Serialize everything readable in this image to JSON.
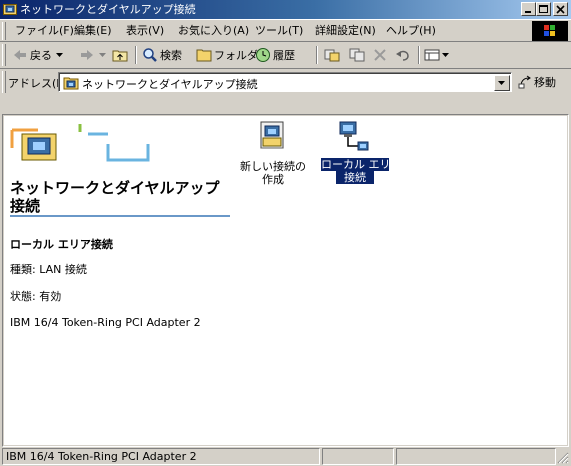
{
  "window": {
    "title": "ネットワークとダイヤルアップ接続",
    "accent": "#0a246a",
    "controls": [
      "minimize-icon",
      "maximize-icon",
      "close-icon"
    ]
  },
  "menu": {
    "items": [
      "ファイル(F)",
      "編集(E)",
      "表示(V)",
      "お気に入り(A)",
      "ツール(T)",
      "詳細設定(N)",
      "ヘルプ(H)"
    ]
  },
  "toolbar": {
    "back_label": "戻る",
    "search_label": "検索",
    "folders_label": "フォルダ",
    "history_label": "履歴"
  },
  "address": {
    "label": "アドレス(D)",
    "value": "ネットワークとダイヤルアップ接続",
    "go_label": "移動"
  },
  "sidebar": {
    "heading_line1": "ネットワークとダイヤルアップ",
    "heading_line2": "接続",
    "selected_name": "ローカル エリア接続",
    "type_text": "種類: LAN 接続",
    "status_text": "状態: 有効",
    "adapter_text": "IBM 16/4 Token-Ring PCI Adapter 2"
  },
  "files": [
    {
      "line1": "新しい接続の",
      "line2": "作成",
      "icon": "new-connection-icon"
    },
    {
      "line1": "ローカル エリア",
      "line2": "接続",
      "icon": "lan-connection-icon",
      "selected": true
    }
  ],
  "statusbar": {
    "text": "IBM 16/4 Token-Ring PCI Adapter 2"
  }
}
